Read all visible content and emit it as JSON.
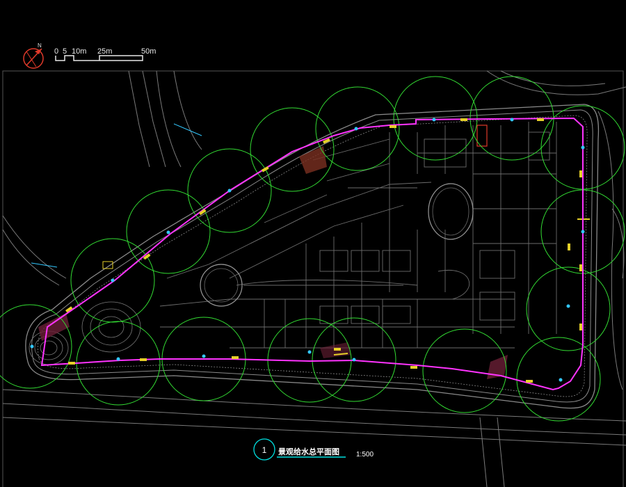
{
  "scale_bar": {
    "labels": [
      "0",
      "5",
      "10m",
      "25m",
      "50m"
    ]
  },
  "north_arrow": {
    "icon": "north-arrow-icon",
    "label": "N"
  },
  "title_block": {
    "number": "1",
    "title": "景观给水总平面图",
    "scale": "1:500"
  },
  "colors": {
    "background": "#000000",
    "site_lines": "#9a9a9a",
    "pipe": "#ff33ff",
    "sprinkler_ring": "#33dd33",
    "node": "#33c8ff",
    "title_underline": "#00e0e0",
    "accent_red": "#e03a2a",
    "accent_yellow": "#e6d028"
  },
  "sprinkler_count": 19
}
